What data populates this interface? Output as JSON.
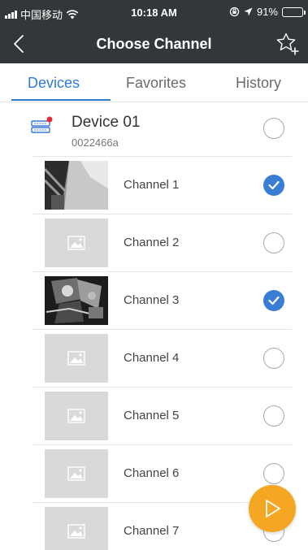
{
  "colors": {
    "nav_background": "#333739",
    "accent_blue": "#2f7bd0",
    "check_blue": "#3a7dd4",
    "fab_orange": "#f5a623",
    "device_red_dot": "#e4293a"
  },
  "status_bar": {
    "carrier": "中国移动",
    "time": "10:18 AM",
    "battery_text": "91%",
    "battery_level": 0.91,
    "icons": [
      "signal-icon",
      "wifi-icon",
      "lock-rotation-icon",
      "location-icon",
      "battery-icon"
    ]
  },
  "nav": {
    "title": "Choose Channel",
    "back_icon": "chevron-left-icon",
    "favorite_icon": "star-plus-icon"
  },
  "tabs": [
    {
      "label": "Devices",
      "active": true
    },
    {
      "label": "Favorites",
      "active": false
    },
    {
      "label": "History",
      "active": false
    }
  ],
  "device": {
    "name": "Device 01",
    "serial": "0022466a",
    "icon": "nvr-device-icon",
    "selected": false
  },
  "channels": [
    {
      "label": "Channel 1",
      "selected": true,
      "thumbnail": "camera-snapshot"
    },
    {
      "label": "Channel 2",
      "selected": false,
      "thumbnail": "image-placeholder-icon"
    },
    {
      "label": "Channel 3",
      "selected": true,
      "thumbnail": "camera-snapshot"
    },
    {
      "label": "Channel 4",
      "selected": false,
      "thumbnail": "image-placeholder-icon"
    },
    {
      "label": "Channel 5",
      "selected": false,
      "thumbnail": "image-placeholder-icon"
    },
    {
      "label": "Channel 6",
      "selected": false,
      "thumbnail": "image-placeholder-icon"
    },
    {
      "label": "Channel 7",
      "selected": false,
      "thumbnail": "image-placeholder-icon"
    }
  ],
  "fab": {
    "icon": "play-icon"
  }
}
